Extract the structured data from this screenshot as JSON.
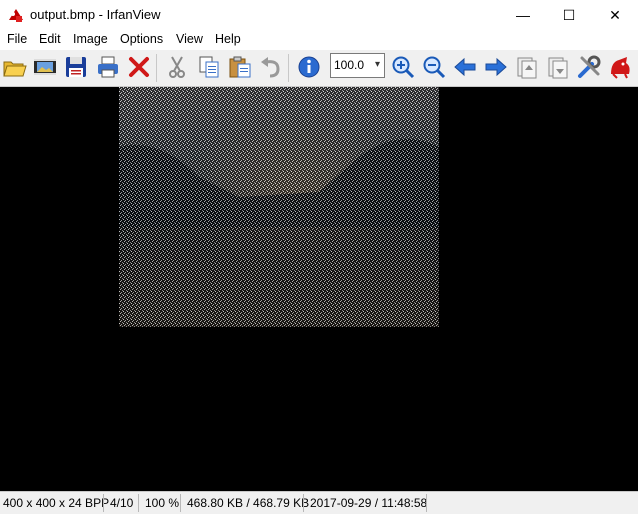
{
  "window": {
    "title": "output.bmp - IrfanView",
    "minimize": "—",
    "maximize": "☐",
    "close": "✕"
  },
  "menu": [
    "File",
    "Edit",
    "Image",
    "Options",
    "View",
    "Help"
  ],
  "toolbar": {
    "buttons": [
      "open-icon",
      "slideshow-icon",
      "save-icon",
      "print-icon",
      "delete-icon",
      "cut-icon",
      "copy-icon",
      "paste-icon",
      "undo-icon",
      "info-icon",
      "zoom-in-icon",
      "zoom-out-icon",
      "previous-icon",
      "next-icon",
      "page-up-icon",
      "page-down-icon",
      "settings-icon",
      "irfan-logo-icon"
    ],
    "zoom_value": "100.0"
  },
  "image": {
    "description_colors": {
      "sky": "#8a8a8a",
      "mountain": "#2c3a4c",
      "glow": "#e0c8a8"
    }
  },
  "status": {
    "dimensions": "400 x 400 x 24 BPP",
    "index": "4/10",
    "zoom": "100 %",
    "size": "468.80 KB / 468.79 KB",
    "datetime": "2017-09-29 / 11:48:58"
  }
}
